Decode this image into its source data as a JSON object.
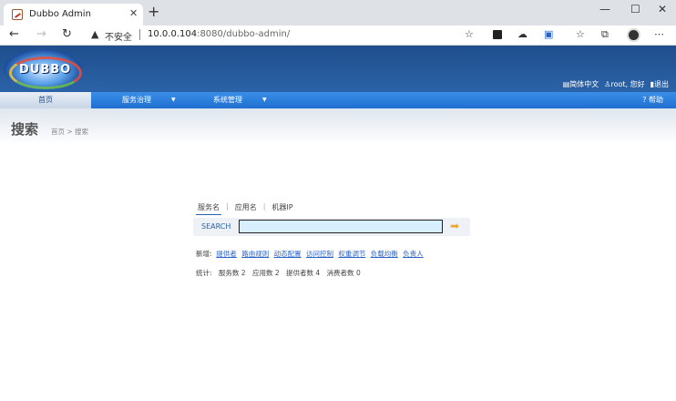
{
  "browser": {
    "tab_title": "Dubbo Admin",
    "insecure_label": "不安全",
    "url_host": "10.0.0.104",
    "url_rest": ":8080/dubbo-admin/"
  },
  "header": {
    "logo_text": "DUBBO",
    "lang_link": "简体中文",
    "user_text": "root, 您好",
    "logout": "退出"
  },
  "menu": {
    "items": [
      {
        "label": "首页"
      },
      {
        "label": "服务治理"
      },
      {
        "label": "系统管理"
      }
    ],
    "help": "帮助"
  },
  "page": {
    "title": "搜索",
    "breadcrumb": "首页 > 搜索"
  },
  "search": {
    "tabs": [
      "服务名",
      "应用名",
      "机器IP"
    ],
    "label": "SEARCH",
    "value": ""
  },
  "add": {
    "prefix": "新增:",
    "links": [
      "提供者",
      "路由规则",
      "动态配置",
      "访问控制",
      "权重调节",
      "负载均衡",
      "负责人"
    ]
  },
  "stats": {
    "prefix": "统计:",
    "items": [
      "服务数 2",
      "应用数 2",
      "提供者数 4",
      "消费者数 0"
    ]
  }
}
